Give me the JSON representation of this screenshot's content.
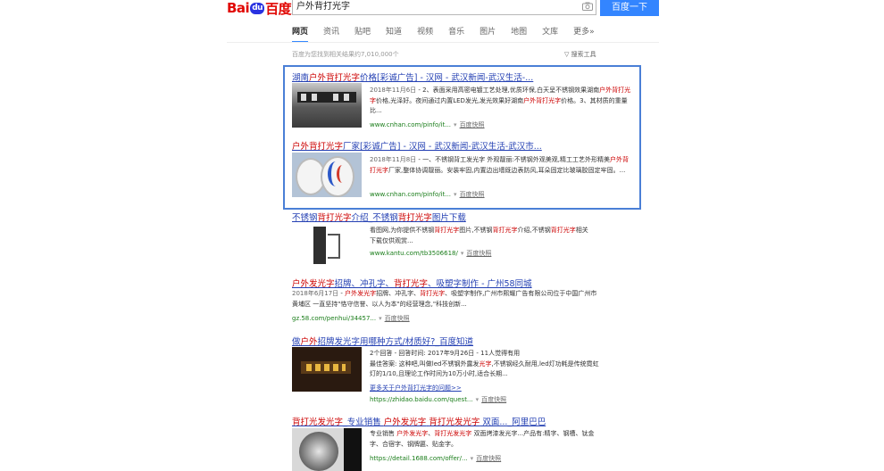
{
  "header": {
    "logo_part1": "Bai",
    "logo_paw": "du",
    "logo_part2": "百度",
    "search_value": "户外背打光字",
    "search_button": "百度一下"
  },
  "tabs": [
    {
      "label": "网页",
      "active": true
    },
    {
      "label": "资讯"
    },
    {
      "label": "贴吧"
    },
    {
      "label": "知道"
    },
    {
      "label": "视频"
    },
    {
      "label": "音乐"
    },
    {
      "label": "图片"
    },
    {
      "label": "地图"
    },
    {
      "label": "文库"
    },
    {
      "label": "更多»"
    }
  ],
  "result_count": "百度为您找到相关结果约7,010,000个",
  "search_tools": "搜索工具",
  "results": [
    {
      "title_html": "湖南<em>户外背打光字</em>价格[彩诚广告] - 汉网 - 武汉新闻-武汉生活-...",
      "date": "2018年11月6日",
      "desc_html": " - 2、表面采用高密电镀工艺处理,优质环保,白天呈不锈钢效果湖南<em>户外背打光字</em>价格,光泽好。夜间通过内置LED发光,发光效果好湖南<em>户外背打光字</em>价格。3、其材质的重量比...",
      "url": "www.cnhan.com/pinfo/it...",
      "snapshot": "百度快照"
    },
    {
      "title_html": "<em>户外背打光字</em>厂家[彩诚广告] - 汉网 - 武汉新闻-武汉生活-武汉市...",
      "date": "2018年11月8日",
      "desc_html": " - 一、不锈钢背工发光字 外观靓丽:不锈钢外观美观,精工工艺外形精美<em>户外背打光字</em>厂家,整体协调靓丽。安装牢固,内置边出墙既边表防风,耳朵固定比玻璃胶固定牢固。...",
      "url": "www.cnhan.com/pinfo/it...",
      "snapshot": "百度快照"
    },
    {
      "title_html": "不锈钢<em>背打光字</em>介绍_不锈钢<em>背打光字</em>图片下载",
      "desc_html": "看图网,为你提供不锈钢<em>背打光字</em>图片,不锈钢<em>背打光字</em>介绍,不锈钢<em>背打光字</em>相关下载仅供观赏...",
      "url": "www.kantu.com/tb3506618/",
      "snapshot": "百度快照"
    },
    {
      "title_html": "<em>户外发光字</em>招牌、冲孔字、<em>背打光字</em>、吸塑字制作 - 广州58同城",
      "date": "2018年6月17日",
      "desc_html": " - <em>户外发光字</em>招牌、冲孔字、<em>背打光字</em>、吸塑字制作,广州市熙耀广告有限公司位于中国广州市黄埔区 一直坚持\"恪守信誉、以人为本\"的经营理念,\"科技创新...",
      "url": "gz.58.com/penhui/34457...",
      "snapshot": "百度快照"
    },
    {
      "title_html": "做<em>户外</em>招牌发光字用哪种方式/材质好?_百度知道",
      "desc_html": "2个回答 - 回答时间: 2017年9月26日 - 11人觉得有用<br>最佳答案: 这种吧,叫做led不锈钢外露发<em>光字</em>,不锈钢经久耐用,led灯功耗是传统霓虹灯的1/10,且理论工作时间为10万小时,适合长期...",
      "more": "更多关于户外背打光字的问题>>",
      "url": "https://zhidao.baidu.com/quest...",
      "snapshot": "百度快照"
    },
    {
      "title_html": "<em>背打光发光字</em>_专业销售 <em>户外发光字</em> <em>背打光发光字</em> 双面..._阿里巴巴",
      "desc_html": "专业销售 <em>户外发光字</em>、<em>背打光发光字</em> 双面烤漆发光字...产品有:精字、钢槽、钛金字、合宿字、钢牌匾、贴金字。",
      "url": "https://detail.1688.com/offer/...",
      "snapshot": "百度快照"
    }
  ],
  "colors": {
    "brand_red": "#e10602",
    "brand_blue": "#3385ff",
    "link": "#2440b3",
    "url_green": "#1a7d1a",
    "highlight_box": "#4a7fd6"
  }
}
